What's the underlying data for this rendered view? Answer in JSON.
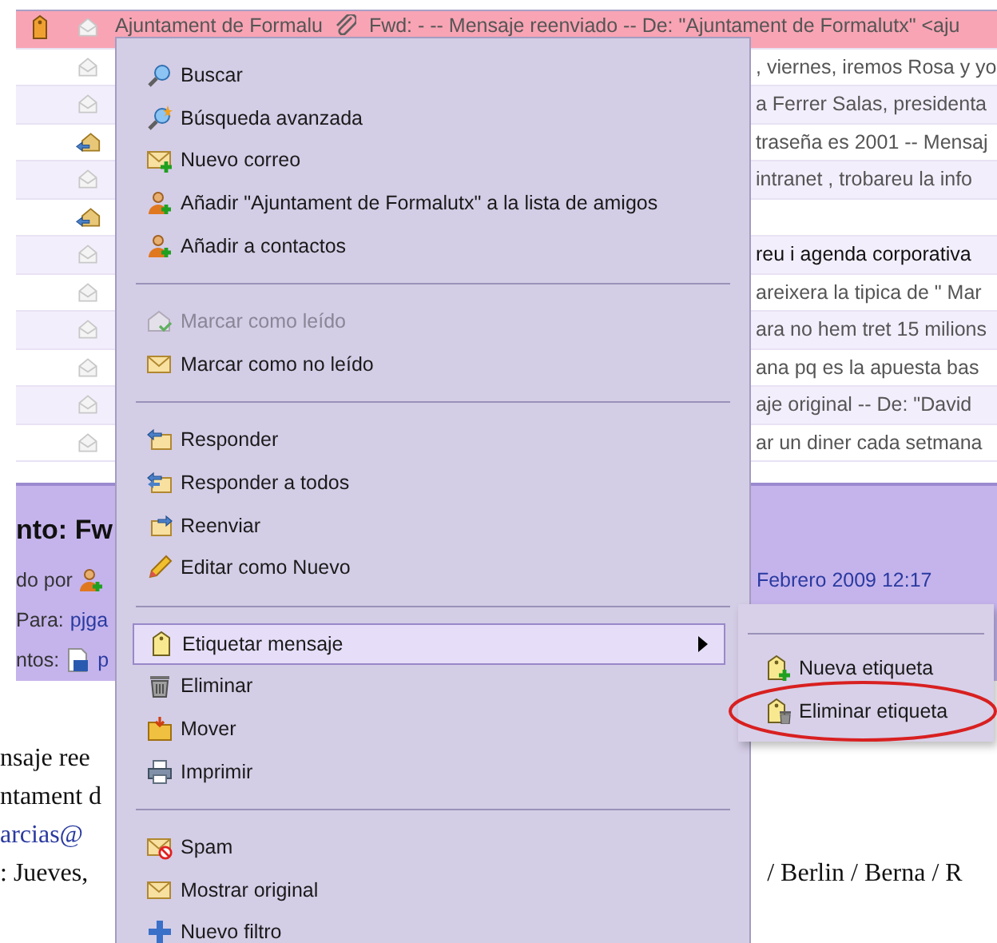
{
  "message_list": {
    "rows": [
      {
        "selected": true,
        "tagged": true,
        "replied": false,
        "unread": false,
        "sender": "Ajuntament de Formalu",
        "attachment": true,
        "subject": "Fwd: - -- Mensaje reenviado -- De: \"Ajuntament de Formalutx\" <aju"
      },
      {
        "selected": false,
        "tagged": false,
        "replied": false,
        "unread": false,
        "subject": ", viernes, iremos Rosa y yo"
      },
      {
        "selected": false,
        "tagged": false,
        "replied": false,
        "unread": false,
        "subject": "a Ferrer Salas, presidenta"
      },
      {
        "selected": false,
        "tagged": false,
        "replied": true,
        "unread": false,
        "subject": "traseña es 2001 -- Mensaj"
      },
      {
        "selected": false,
        "tagged": false,
        "replied": false,
        "unread": false,
        "subject": " intranet , trobareu la info"
      },
      {
        "selected": false,
        "tagged": false,
        "replied": true
      },
      {
        "selected": false,
        "tagged": false,
        "replied": false,
        "unread": true,
        "subject": "reu i agenda corporativa"
      },
      {
        "selected": false,
        "tagged": false,
        "replied": false,
        "unread": false,
        "subject": "areixera la tipica de \" Mar"
      },
      {
        "selected": false,
        "tagged": false,
        "replied": false,
        "unread": false,
        "subject": "ara no hem tret 15 milions"
      },
      {
        "selected": false,
        "tagged": false,
        "replied": false,
        "unread": false,
        "subject": "ana pq es la apuesta bas"
      },
      {
        "selected": false,
        "tagged": false,
        "replied": false,
        "unread": false,
        "subject": "aje original -- De: \"David"
      },
      {
        "selected": false,
        "tagged": false,
        "replied": false,
        "unread": false,
        "subject": "ar un diner cada setmana"
      }
    ]
  },
  "message_header": {
    "title": "nto: Fw",
    "sent_by_label": "do por",
    "to_label": "Para:",
    "to_value": "pjga",
    "attachments_label": "ntos:",
    "attachment_name": "p",
    "date": "Febrero 2009 12:17"
  },
  "message_body": {
    "lines": [
      "nsaje ree",
      "ntament d",
      "arcias@",
      ": Jueves,"
    ],
    "line_right": "/ Berlin / Berna / R"
  },
  "context_menu": {
    "items": [
      {
        "kind": "item",
        "label": "Buscar",
        "disabled": false,
        "selected": false
      },
      {
        "kind": "item",
        "label": "Búsqueda avanzada",
        "disabled": false,
        "selected": false
      },
      {
        "kind": "item",
        "label": "Nuevo correo",
        "disabled": false,
        "selected": false
      },
      {
        "kind": "item",
        "label": "Añadir \"Ajuntament de Formalutx\" a la lista de amigos",
        "disabled": false,
        "selected": false
      },
      {
        "kind": "item",
        "label": "Añadir a contactos",
        "disabled": false,
        "selected": false
      },
      {
        "kind": "separator"
      },
      {
        "kind": "item",
        "label": "Marcar como leído",
        "disabled": true,
        "selected": false
      },
      {
        "kind": "item",
        "label": "Marcar como no leído",
        "disabled": false,
        "selected": false
      },
      {
        "kind": "separator"
      },
      {
        "kind": "item",
        "label": "Responder",
        "disabled": false,
        "selected": false
      },
      {
        "kind": "item",
        "label": "Responder a todos",
        "disabled": false,
        "selected": false
      },
      {
        "kind": "item",
        "label": "Reenviar",
        "disabled": false,
        "selected": false
      },
      {
        "kind": "item",
        "label": "Editar como Nuevo",
        "disabled": false,
        "selected": false
      },
      {
        "kind": "separator"
      },
      {
        "kind": "submenu",
        "label": "Etiquetar mensaje",
        "disabled": false,
        "selected": true
      },
      {
        "kind": "item",
        "label": "Eliminar",
        "disabled": false,
        "selected": false
      },
      {
        "kind": "item",
        "label": "Mover",
        "disabled": false,
        "selected": false
      },
      {
        "kind": "item",
        "label": "Imprimir",
        "disabled": false,
        "selected": false
      },
      {
        "kind": "separator"
      },
      {
        "kind": "item",
        "label": "Spam",
        "disabled": false,
        "selected": false
      },
      {
        "kind": "item",
        "label": "Mostrar original",
        "disabled": false,
        "selected": false
      },
      {
        "kind": "item",
        "label": "Nuevo filtro",
        "disabled": false,
        "selected": false
      }
    ]
  },
  "submenu": {
    "items": [
      {
        "kind": "separator"
      },
      {
        "kind": "item",
        "label": "Nueva etiqueta",
        "selected": false,
        "circled": false
      },
      {
        "kind": "item",
        "label": "Eliminar etiqueta",
        "selected": false,
        "circled": true
      }
    ]
  }
}
